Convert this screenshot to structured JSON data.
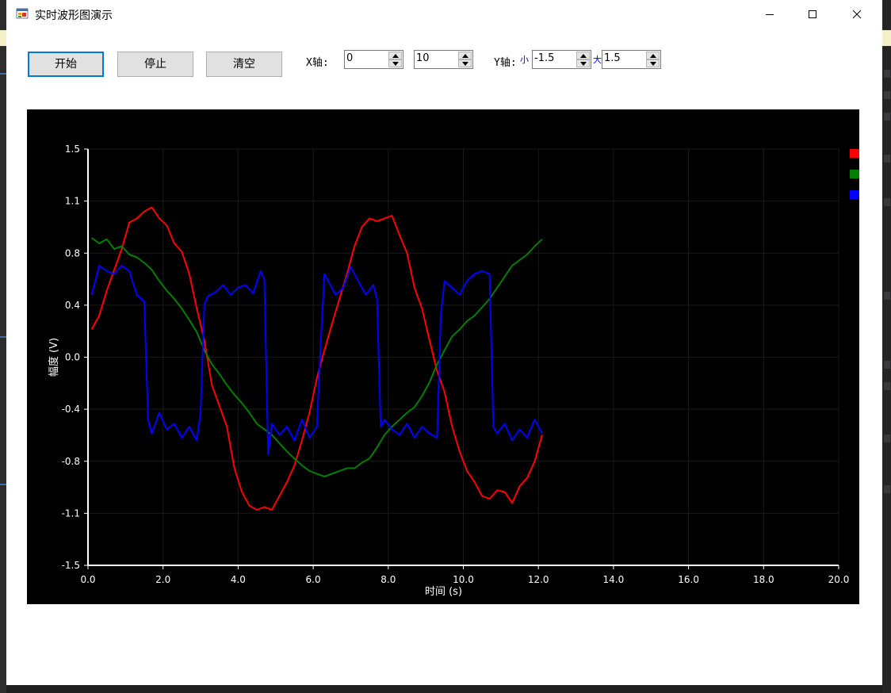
{
  "window": {
    "title": "实时波形图演示"
  },
  "toolbar": {
    "start_label": "开始",
    "stop_label": "停止",
    "clear_label": "清空",
    "x_axis_label": "X轴:",
    "x_min": "0",
    "x_max": "10",
    "y_axis_label": "Y轴:",
    "y_min_label": "小",
    "y_min": "-1.5",
    "y_max_label": "大",
    "y_max": "1.5"
  },
  "colors": {
    "chart_bg": "#000000",
    "accent": "#0078d7",
    "series": [
      "#ff0000",
      "#008000",
      "#0000ff"
    ]
  },
  "icons": {
    "app": "winforms-app-icon",
    "minimize": "minimize-icon",
    "maximize": "maximize-icon",
    "close": "close-icon",
    "spin_up": "chevron-up-icon",
    "spin_down": "chevron-down-icon"
  },
  "chart_data": {
    "type": "line",
    "xlabel": "时间 (s)",
    "ylabel": "幅度 (V)",
    "xlim": [
      0,
      20
    ],
    "ylim": [
      -1.5,
      1.5
    ],
    "x_ticks": [
      "0.0",
      "2.0",
      "4.0",
      "6.0",
      "8.0",
      "10.0",
      "12.0",
      "14.0",
      "16.0",
      "18.0",
      "20.0"
    ],
    "y_ticks": [
      "1.5",
      "1.1",
      "0.8",
      "0.4",
      "0.0",
      "-0.4",
      "-0.8",
      "-1.1",
      "-1.5"
    ],
    "grid": true,
    "legend": "top-right",
    "series": [
      {
        "color": "#ff0000",
        "x": [
          0.1,
          0.3,
          0.5,
          0.7,
          0.9,
          1.1,
          1.3,
          1.5,
          1.7,
          1.9,
          2.1,
          2.3,
          2.5,
          2.7,
          2.9,
          3.1,
          3.3,
          3.5,
          3.7,
          3.9,
          4.1,
          4.3,
          4.5,
          4.7,
          4.9,
          5.1,
          5.3,
          5.5,
          5.7,
          5.9,
          6.1,
          6.3,
          6.5,
          6.7,
          6.9,
          7.1,
          7.3,
          7.5,
          7.7,
          7.9,
          8.1,
          8.3,
          8.5,
          8.7,
          8.9,
          9.1,
          9.3,
          9.5,
          9.7,
          9.9,
          10.1,
          10.3,
          10.5,
          10.7,
          10.9,
          11.1,
          11.3,
          11.5,
          11.7,
          11.9,
          12.1
        ],
        "values": [
          0.2,
          0.3,
          0.48,
          0.63,
          0.78,
          0.97,
          1.0,
          1.05,
          1.08,
          1.0,
          0.95,
          0.82,
          0.76,
          0.6,
          0.35,
          0.12,
          -0.2,
          -0.35,
          -0.5,
          -0.8,
          -0.97,
          -1.07,
          -1.1,
          -1.08,
          -1.1,
          -1.0,
          -0.9,
          -0.78,
          -0.6,
          -0.4,
          -0.15,
          0.05,
          0.24,
          0.42,
          0.6,
          0.8,
          0.94,
          1.0,
          0.98,
          1.0,
          1.02,
          0.88,
          0.75,
          0.5,
          0.35,
          0.12,
          -0.1,
          -0.25,
          -0.5,
          -0.68,
          -0.82,
          -0.9,
          -1.0,
          -1.02,
          -0.96,
          -0.97,
          -1.05,
          -0.93,
          -0.87,
          -0.75,
          -0.56
        ]
      },
      {
        "color": "#008000",
        "x": [
          0.1,
          0.3,
          0.5,
          0.7,
          0.9,
          1.1,
          1.3,
          1.5,
          1.7,
          1.9,
          2.1,
          2.3,
          2.5,
          2.7,
          2.9,
          3.1,
          3.3,
          3.5,
          3.7,
          3.9,
          4.1,
          4.3,
          4.5,
          4.7,
          4.9,
          5.1,
          5.3,
          5.5,
          5.7,
          5.9,
          6.1,
          6.3,
          6.5,
          6.7,
          6.9,
          7.1,
          7.3,
          7.5,
          7.7,
          7.9,
          8.1,
          8.3,
          8.5,
          8.7,
          8.9,
          9.1,
          9.3,
          9.5,
          9.7,
          9.9,
          10.1,
          10.3,
          10.5,
          10.7,
          10.9,
          11.1,
          11.3,
          11.5,
          11.7,
          11.9,
          12.1
        ],
        "values": [
          0.86,
          0.82,
          0.85,
          0.78,
          0.8,
          0.74,
          0.72,
          0.68,
          0.63,
          0.55,
          0.48,
          0.42,
          0.35,
          0.27,
          0.18,
          0.05,
          -0.05,
          -0.12,
          -0.2,
          -0.27,
          -0.33,
          -0.4,
          -0.48,
          -0.52,
          -0.56,
          -0.62,
          -0.68,
          -0.73,
          -0.78,
          -0.82,
          -0.84,
          -0.86,
          -0.84,
          -0.82,
          -0.8,
          -0.8,
          -0.76,
          -0.73,
          -0.65,
          -0.56,
          -0.5,
          -0.45,
          -0.4,
          -0.36,
          -0.28,
          -0.18,
          -0.05,
          0.05,
          0.15,
          0.2,
          0.26,
          0.3,
          0.36,
          0.42,
          0.5,
          0.58,
          0.66,
          0.7,
          0.74,
          0.8,
          0.85
        ]
      },
      {
        "color": "#0000ff",
        "x": [
          0.1,
          0.3,
          0.5,
          0.7,
          0.9,
          1.1,
          1.3,
          1.5,
          1.6,
          1.7,
          1.9,
          2.1,
          2.3,
          2.5,
          2.7,
          2.9,
          3.0,
          3.1,
          3.2,
          3.4,
          3.6,
          3.8,
          4.0,
          4.2,
          4.4,
          4.6,
          4.7,
          4.8,
          4.9,
          5.1,
          5.3,
          5.5,
          5.7,
          5.9,
          6.1,
          6.2,
          6.3,
          6.4,
          6.6,
          6.8,
          7.0,
          7.2,
          7.4,
          7.6,
          7.7,
          7.8,
          7.9,
          8.1,
          8.3,
          8.5,
          8.7,
          8.9,
          9.1,
          9.3,
          9.4,
          9.5,
          9.7,
          9.9,
          10.1,
          10.3,
          10.5,
          10.7,
          10.8,
          10.9,
          11.1,
          11.3,
          11.5,
          11.7,
          11.9,
          12.1
        ],
        "values": [
          0.45,
          0.66,
          0.62,
          0.6,
          0.66,
          0.62,
          0.45,
          0.4,
          -0.45,
          -0.55,
          -0.4,
          -0.52,
          -0.48,
          -0.58,
          -0.5,
          -0.6,
          -0.4,
          0.38,
          0.44,
          0.47,
          0.52,
          0.45,
          0.5,
          0.52,
          0.46,
          0.62,
          0.56,
          -0.7,
          -0.48,
          -0.56,
          -0.5,
          -0.6,
          -0.45,
          -0.58,
          -0.5,
          0.1,
          0.6,
          0.55,
          0.45,
          0.5,
          0.65,
          0.55,
          0.45,
          0.52,
          0.42,
          -0.5,
          -0.45,
          -0.52,
          -0.56,
          -0.48,
          -0.58,
          -0.5,
          -0.55,
          -0.58,
          0.3,
          0.55,
          0.5,
          0.45,
          0.55,
          0.6,
          0.62,
          0.6,
          -0.5,
          -0.55,
          -0.48,
          -0.6,
          -0.52,
          -0.58,
          -0.45,
          -0.55
        ]
      }
    ]
  }
}
